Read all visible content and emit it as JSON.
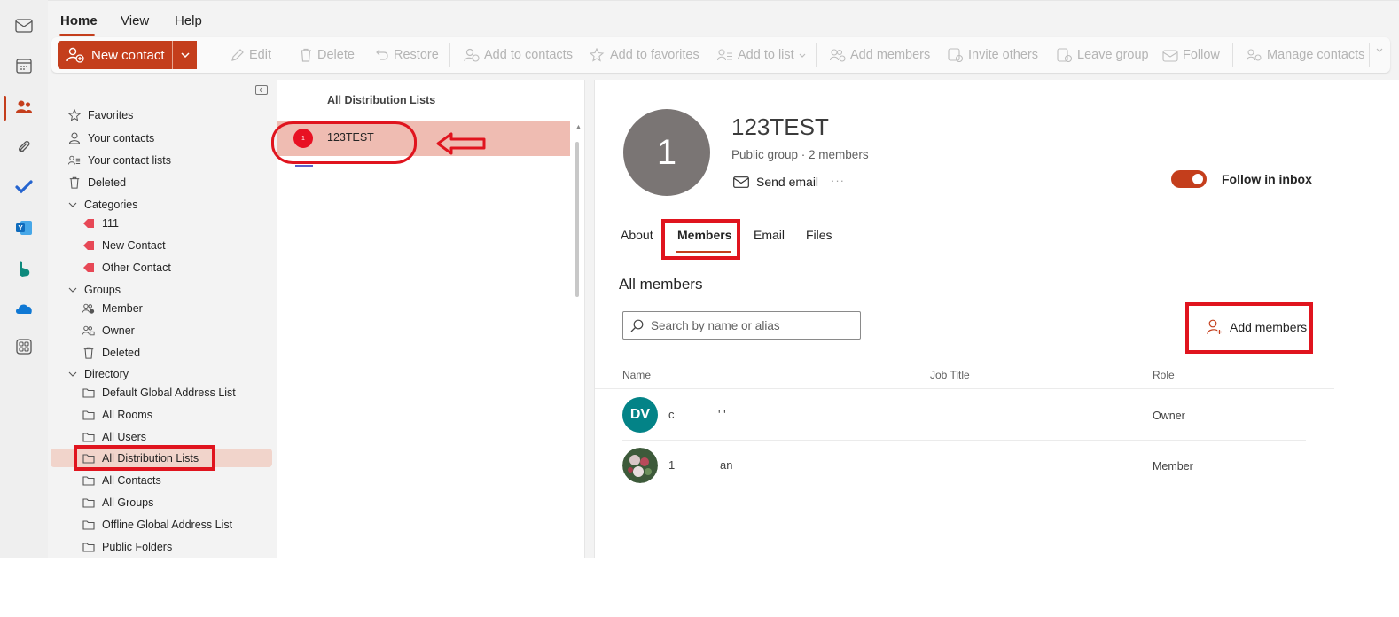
{
  "ribbon_tabs": [
    "Home",
    "View",
    "Help"
  ],
  "ribbon": {
    "new_contact": "New contact",
    "commands": [
      "Edit",
      "Delete",
      "Restore",
      "Add to contacts",
      "Add to favorites",
      "Add to list",
      "Add members",
      "Invite others",
      "Leave group",
      "Follow",
      "Manage contacts"
    ]
  },
  "nav": {
    "favorites": "Favorites",
    "your_contacts": "Your contacts",
    "your_contact_lists": "Your contact lists",
    "deleted": "Deleted",
    "categories": {
      "label": "Categories",
      "items": [
        "111",
        "New Contact",
        "Other Contact"
      ]
    },
    "groups": {
      "label": "Groups",
      "items": [
        "Member",
        "Owner",
        "Deleted"
      ]
    },
    "directory": {
      "label": "Directory",
      "items": [
        "Default Global Address List",
        "All Rooms",
        "All Users",
        "All Distribution Lists",
        "All Contacts",
        "All Groups",
        "Offline Global Address List",
        "Public Folders"
      ],
      "selected": "All Distribution Lists"
    }
  },
  "list": {
    "header": "All Distribution Lists",
    "rows": [
      {
        "avatar": "1",
        "name": "123TEST"
      }
    ]
  },
  "detail": {
    "avatar_text": "1",
    "name": "123TEST",
    "subtitle": "Public group · 2 members",
    "send_email": "Send email",
    "more": "···",
    "follow_label": "Follow in inbox",
    "follow_on": true,
    "tabs": [
      "About",
      "Members",
      "Email",
      "Files"
    ],
    "active_tab": "Members",
    "section_title": "All members",
    "search_placeholder": "Search by name or alias",
    "add_members": "Add members",
    "columns": {
      "name": "Name",
      "job_title": "Job Title",
      "role": "Role"
    },
    "members": [
      {
        "initials": "DV",
        "name_a": "c",
        "name_b": "' '",
        "role": "Owner"
      },
      {
        "initials": "",
        "name_a": "1",
        "name_b": "an",
        "role": "Member"
      }
    ]
  },
  "colors": {
    "accent": "#c43e1c",
    "annotation": "#e0141e",
    "dv_avatar": "#038387"
  }
}
